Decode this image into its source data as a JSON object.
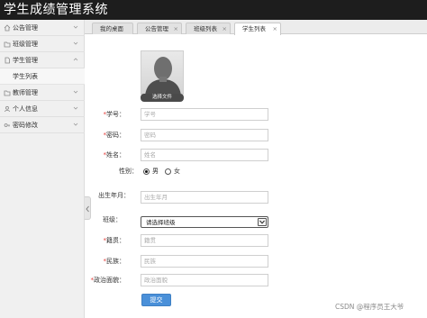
{
  "header": {
    "title": "学生成绩管理系统"
  },
  "sidebar": {
    "items": [
      {
        "label": "公告管理",
        "icon": "home-icon",
        "expanded": false
      },
      {
        "label": "班级管理",
        "icon": "folder-icon",
        "expanded": false
      },
      {
        "label": "学生管理",
        "icon": "document-icon",
        "expanded": true,
        "children": [
          {
            "label": "学生列表"
          }
        ]
      },
      {
        "label": "教师管理",
        "icon": "folder-icon",
        "expanded": false
      },
      {
        "label": "个人信息",
        "icon": "user-icon",
        "expanded": false
      },
      {
        "label": "密码修改",
        "icon": "key-icon",
        "expanded": false
      }
    ]
  },
  "tabs": [
    {
      "label": "我的桌面",
      "closable": false,
      "active": false
    },
    {
      "label": "公告管理",
      "closable": true,
      "active": false
    },
    {
      "label": "班级列表",
      "closable": true,
      "active": false
    },
    {
      "label": "学生列表",
      "closable": true,
      "active": true
    }
  ],
  "tab_close_glyph": "×",
  "form": {
    "choose_file_label": "选择文件",
    "fields": {
      "student_no": {
        "required": true,
        "label": "学号：",
        "placeholder": "学号",
        "value": ""
      },
      "password": {
        "required": true,
        "label": "密码：",
        "placeholder": "密码",
        "value": ""
      },
      "name": {
        "required": true,
        "label": "姓名：",
        "placeholder": "姓名",
        "value": ""
      },
      "gender": {
        "label": "性别：",
        "options": [
          "男",
          "女"
        ],
        "selected": "男"
      },
      "birth_month": {
        "label": "出生年月：",
        "placeholder": "出生年月",
        "value": ""
      },
      "class": {
        "label": "班级：",
        "selected_text": "请选择班级"
      },
      "native_place": {
        "required": true,
        "label": "籍贯：",
        "placeholder": "籍贯",
        "value": ""
      },
      "ethnicity": {
        "required": true,
        "label": "民族：",
        "placeholder": "民族",
        "value": ""
      },
      "political_status": {
        "required": true,
        "label": "政治面貌：",
        "placeholder": "政治面貌",
        "value": ""
      }
    },
    "required_mark": "*",
    "submit_label": "提交"
  },
  "watermark": "CSDN @程序员王大爷",
  "colors": {
    "header_bg": "#1d1d1d",
    "required": "#e53935",
    "submit_bg": "#4a90d9",
    "sidebar_bg": "#f0f0f0"
  }
}
